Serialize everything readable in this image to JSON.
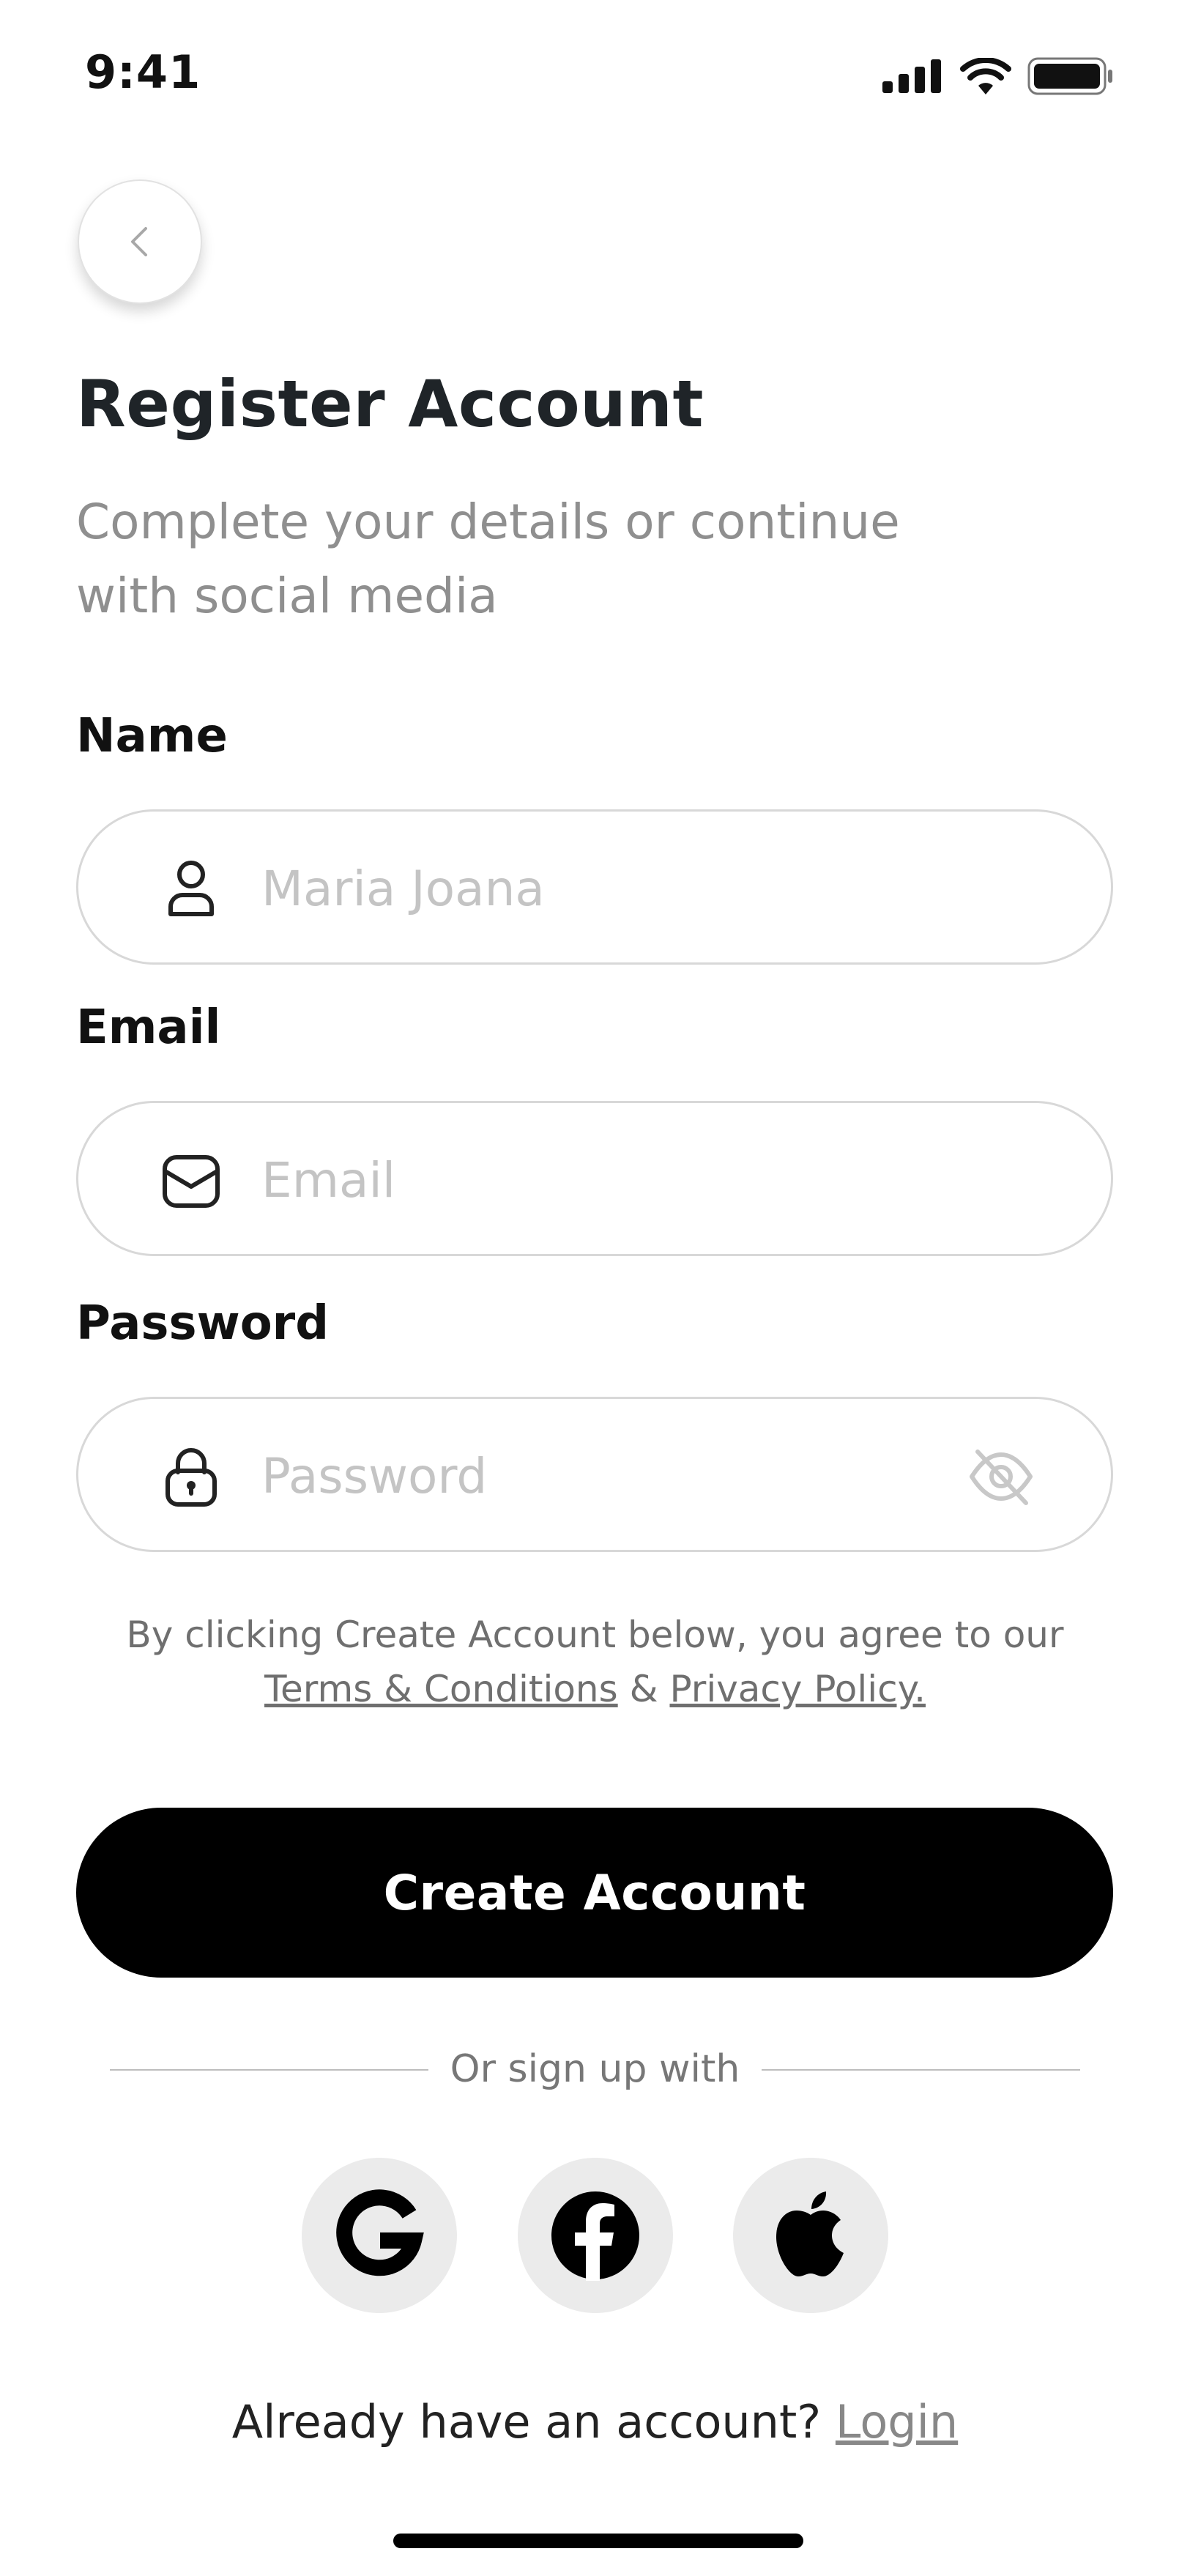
{
  "status_bar": {
    "time": "9:41"
  },
  "header": {
    "title": "Register Account",
    "subtitle": "Complete your details or continue with social media"
  },
  "form": {
    "name": {
      "label": "Name",
      "placeholder": "Maria Joana",
      "value": ""
    },
    "email": {
      "label": "Email",
      "placeholder": "Email",
      "value": ""
    },
    "password": {
      "label": "Password",
      "placeholder": "Password",
      "value": ""
    }
  },
  "terms": {
    "prefix": "By clicking Create Account below, you agree to our",
    "terms_link": "Terms & Conditions",
    "joiner": "&",
    "privacy_link": "Privacy Policy."
  },
  "create_button": "Create Account",
  "divider_text": "Or sign up with",
  "social": [
    "google-icon",
    "facebook-icon",
    "apple-icon"
  ],
  "login": {
    "prompt": "Already have an account?",
    "link": "Login"
  },
  "colors": {
    "primary": "#000000",
    "title": "#1f2428",
    "muted": "#8f8f8f",
    "placeholder": "#c4c4c4",
    "field_border": "#d8d8d8",
    "social_bg": "#ebebeb"
  }
}
